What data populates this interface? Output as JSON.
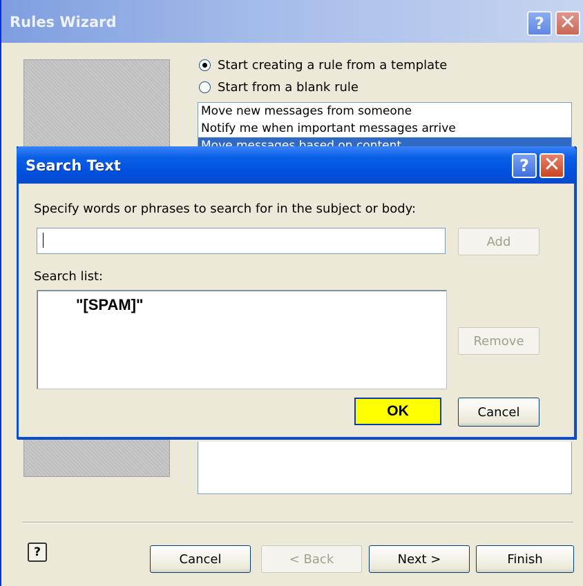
{
  "rules_wizard": {
    "title": "Rules Wizard",
    "radio_template": "Start creating a rule from a template",
    "radio_blank": "Start from a blank rule",
    "template_items": [
      "Move new messages from someone",
      "Notify me when important messages arrive",
      "Move messages based on content"
    ],
    "buttons": {
      "cancel": "Cancel",
      "back": "< Back",
      "next": "Next >",
      "finish": "Finish"
    },
    "help_icon": "?"
  },
  "search_text_dialog": {
    "title": "Search Text",
    "prompt": "Specify words or phrases to search for in the subject or body:",
    "search_input_value": "",
    "search_list_label": "Search list:",
    "search_list_items": [
      "\"[SPAM]\""
    ],
    "buttons": {
      "add": "Add",
      "remove": "Remove",
      "ok": "OK",
      "cancel": "Cancel"
    }
  },
  "icons": {
    "help": "?",
    "close": "✕"
  },
  "colors": {
    "xp_title_blue": "#0a5fe6",
    "selection_blue": "#316ac5",
    "ok_highlight": "#ffff00"
  }
}
